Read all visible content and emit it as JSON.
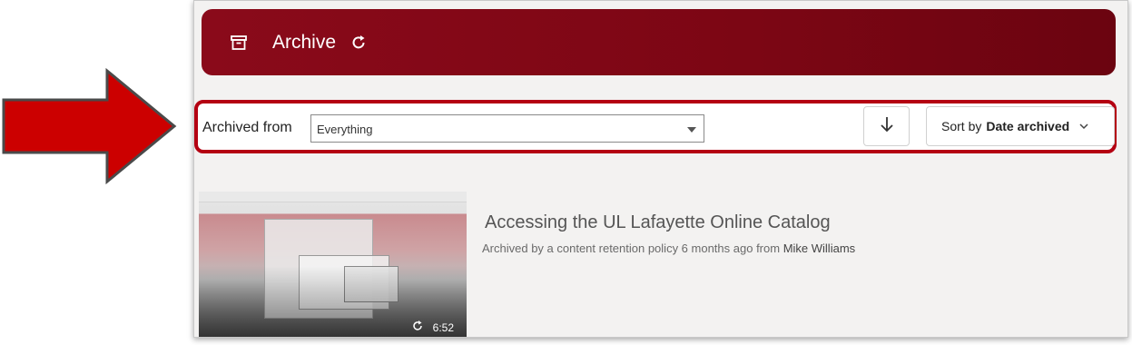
{
  "header": {
    "title": "Archive",
    "archive_icon": "archive-box-icon",
    "refresh_icon": "refresh-icon",
    "color": "#7c0614"
  },
  "filter": {
    "label": "Archived from",
    "selected": "Everything",
    "highlight_color": "#b40012"
  },
  "sort": {
    "direction_icon": "arrow-down-icon",
    "prefix": "Sort by",
    "value": "Date archived",
    "chevron_icon": "chevron-down-icon"
  },
  "items": [
    {
      "title": "Accessing the UL Lafayette Online Catalog",
      "meta_prefix": "Archived by a content retention policy 6 months ago from",
      "author": "Mike Williams",
      "duration": "6:52"
    }
  ],
  "annotation": {
    "pointer_icon": "red-arrow-icon",
    "color": "#cc0000"
  }
}
